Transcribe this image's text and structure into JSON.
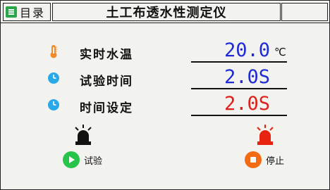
{
  "header": {
    "menu_label": "目录",
    "title": "土工布透水性测定仪"
  },
  "rows": [
    {
      "label": "实时水温",
      "value": "20.0",
      "unit": "℃",
      "icon": "thermometer-icon",
      "value_color": "#1f2bd6"
    },
    {
      "label": "试验时间",
      "value": "2.0S",
      "icon": "clock-icon",
      "value_color": "#1f2bd6"
    },
    {
      "label": "时间设定",
      "value": "2.0S",
      "icon": "clock-icon",
      "value_color": "#e0201c"
    }
  ],
  "indicators": {
    "test_lamp": {
      "icon": "alarm-lamp-icon",
      "state": "off"
    },
    "stop_lamp": {
      "icon": "alarm-lamp-icon",
      "state": "on"
    }
  },
  "controls": {
    "test_label": "试验",
    "stop_label": "停止"
  },
  "colors": {
    "menu_icon": "#2aa64a",
    "clock": "#29a9e8",
    "thermometer": "#f08a2a",
    "test_button": "#27c44a",
    "stop_button": "#f36a12",
    "lamp_on": "#e8230f"
  }
}
